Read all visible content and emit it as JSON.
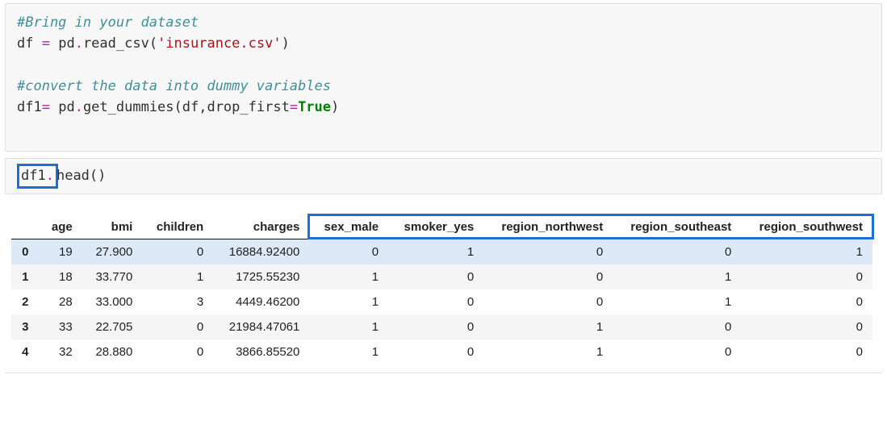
{
  "cell1": {
    "line1_comment": "#Bring in your dataset",
    "line2_a": "df ",
    "line2_op": "=",
    "line2_b": " pd",
    "line2_dot1": ".",
    "line2_c": "read_csv(",
    "line2_str": "'insurance.csv'",
    "line2_d": ")",
    "line3_blank": "",
    "line4_comment": "#convert the data into dummy variables",
    "line5_a": "df1",
    "line5_op1": "=",
    "line5_b": " pd",
    "line5_dot1": ".",
    "line5_c": "get_dummies(df,drop_first",
    "line5_op2": "=",
    "line5_kw": "True",
    "line5_d": ")"
  },
  "cell2": {
    "part1": "df1",
    "cursor": ".",
    "part2": "head()"
  },
  "table": {
    "headers": [
      "",
      "age",
      "bmi",
      "children",
      "charges",
      "sex_male",
      "smoker_yes",
      "region_northwest",
      "region_southeast",
      "region_southwest"
    ],
    "rows": [
      {
        "idx": "0",
        "age": "19",
        "bmi": "27.900",
        "children": "0",
        "charges": "16884.92400",
        "sex_male": "0",
        "smoker_yes": "1",
        "region_northwest": "0",
        "region_southeast": "0",
        "region_southwest": "1"
      },
      {
        "idx": "1",
        "age": "18",
        "bmi": "33.770",
        "children": "1",
        "charges": "1725.55230",
        "sex_male": "1",
        "smoker_yes": "0",
        "region_northwest": "0",
        "region_southeast": "1",
        "region_southwest": "0"
      },
      {
        "idx": "2",
        "age": "28",
        "bmi": "33.000",
        "children": "3",
        "charges": "4449.46200",
        "sex_male": "1",
        "smoker_yes": "0",
        "region_northwest": "0",
        "region_southeast": "1",
        "region_southwest": "0"
      },
      {
        "idx": "3",
        "age": "33",
        "bmi": "22.705",
        "children": "0",
        "charges": "21984.47061",
        "sex_male": "1",
        "smoker_yes": "0",
        "region_northwest": "1",
        "region_southeast": "0",
        "region_southwest": "0"
      },
      {
        "idx": "4",
        "age": "32",
        "bmi": "28.880",
        "children": "0",
        "charges": "3866.85520",
        "sex_male": "1",
        "smoker_yes": "0",
        "region_northwest": "1",
        "region_southeast": "0",
        "region_southwest": "0"
      }
    ],
    "highlight_start_col": 5,
    "selected_row": 0
  }
}
